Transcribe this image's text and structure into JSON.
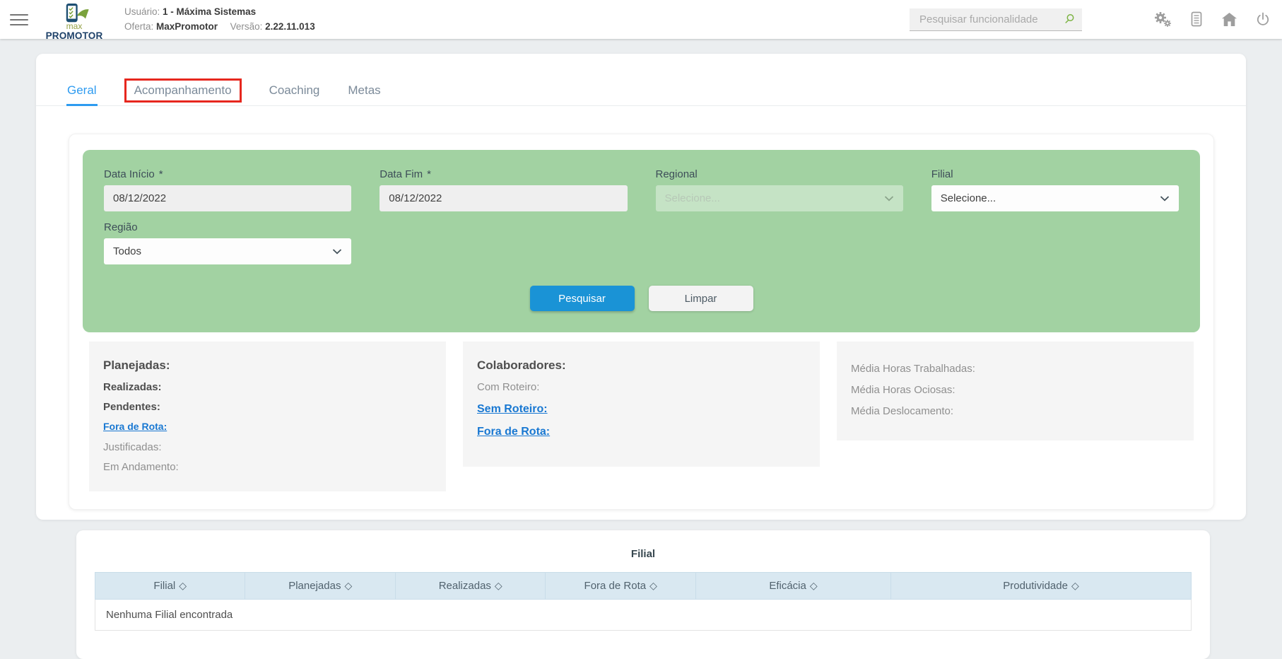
{
  "header": {
    "logo": {
      "top": "max",
      "bottom": "PROMOTOR"
    },
    "user_label": "Usuário:",
    "user_value": "1 - Máxima Sistemas",
    "offer_label": "Oferta:",
    "offer_value": "MaxPromotor",
    "version_label": "Versão:",
    "version_value": "2.22.11.013",
    "search_placeholder": "Pesquisar funcionalidade"
  },
  "tabs": {
    "geral": "Geral",
    "acompanhamento": "Acompanhamento",
    "coaching": "Coaching",
    "metas": "Metas"
  },
  "filters": {
    "required_mark": "*",
    "data_inicio_label": "Data Início",
    "data_inicio_value": "08/12/2022",
    "data_fim_label": "Data Fim",
    "data_fim_value": "08/12/2022",
    "regional_label": "Regional",
    "regional_value": "Selecione...",
    "filial_label": "Filial",
    "filial_value": "Selecione...",
    "regiao_label": "Região",
    "regiao_value": "Todos",
    "search_button": "Pesquisar",
    "clear_button": "Limpar"
  },
  "stats": {
    "visits": {
      "title": "Planejadas:",
      "realizadas": "Realizadas:",
      "pendentes": "Pendentes:",
      "fora_de_rota": "Fora de Rota:",
      "justificadas": "Justificadas:",
      "em_andamento": "Em Andamento:"
    },
    "collaborators": {
      "title": "Colaboradores:",
      "com_roteiro": "Com Roteiro:",
      "sem_roteiro": "Sem Roteiro:",
      "fora_de_rota": "Fora de Rota:"
    },
    "averages": {
      "horas_trabalhadas": "Média Horas Trabalhadas:",
      "horas_ociosas": "Média Horas Ociosas:",
      "deslocamento": "Média Deslocamento:"
    }
  },
  "table": {
    "title": "Filial",
    "columns": [
      "Filial",
      "Planejadas",
      "Realizadas",
      "Fora de Rota",
      "Eficácia",
      "Produtividade"
    ],
    "sort_icon": "◇",
    "empty_message": "Nenhuma Filial encontrada"
  },
  "colors": {
    "accent_blue": "#1a93d6",
    "tab_active_blue": "#2e9bf0",
    "panel_green": "#a2d2a2",
    "link_blue": "#1978d2",
    "annotation_red": "#e6271e",
    "table_header_bg": "#d9e8f1",
    "logo_green": "#7aa23c",
    "logo_navy": "#1d4f72",
    "icon_gray": "#9e9e9e"
  }
}
